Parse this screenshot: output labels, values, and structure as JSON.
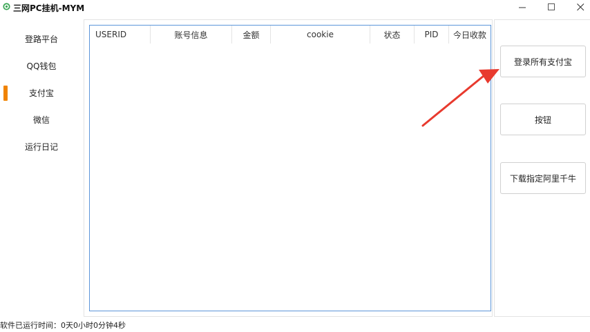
{
  "window": {
    "title": "三网PC挂机-MYM",
    "icon": "gear-icon",
    "controls": [
      "minimize-icon",
      "maximize-icon",
      "close-icon"
    ]
  },
  "sidebar": {
    "items": [
      {
        "label": "登路平台",
        "active": false
      },
      {
        "label": "QQ钱包",
        "active": false
      },
      {
        "label": "支付宝",
        "active": true
      },
      {
        "label": "微信",
        "active": false
      },
      {
        "label": "运行日记",
        "active": false
      }
    ],
    "accent": "#f08300"
  },
  "grid": {
    "columns": [
      "USERID",
      "账号信息",
      "金额",
      "cookie",
      "状态",
      "PID",
      "今日收款"
    ],
    "rows": [],
    "border_color": "#5b95d9"
  },
  "actions": {
    "login_all_alipay": "登录所有支付宝",
    "button": "按钮",
    "download_qianniu": "下载指定阿里千牛"
  },
  "status": {
    "runtime": "软件已运行时间：0天0小时0分钟4秒"
  },
  "annotation": {
    "arrow_color": "#e83a2e"
  }
}
